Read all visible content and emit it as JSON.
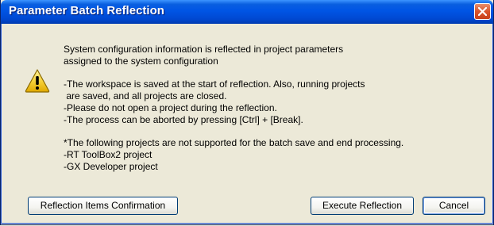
{
  "window": {
    "title": "Parameter Batch Reflection"
  },
  "message": {
    "line1": "System configuration information is reflected in project parameters",
    "line2": "assigned to the system configuration",
    "line3": "-The workspace is saved at the start of reflection. Also, running projects",
    "line4": " are saved, and all projects are closed.",
    "line5": "-Please do not open a project during the reflection.",
    "line6": "-The process can be aborted by pressing [Ctrl] + [Break].",
    "line7": "*The following projects are not supported for the batch save and end processing.",
    "line8": "-RT ToolBox2 project",
    "line9": "-GX Developer project"
  },
  "buttons": {
    "reflection_items": "Reflection Items Confirmation",
    "execute": "Execute Reflection",
    "cancel": "Cancel"
  },
  "icons": {
    "dialog_icon": "warning-icon",
    "close": "close-icon"
  },
  "colors": {
    "titlebar": "#0055e5",
    "close_button": "#d9542b",
    "dialog_background": "#ece9d8",
    "warning_fill": "#f7d23c"
  }
}
